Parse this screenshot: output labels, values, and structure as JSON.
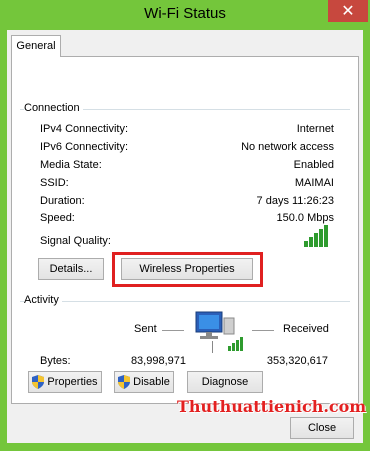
{
  "window": {
    "title": "Wi-Fi Status",
    "close_glyph": "✕"
  },
  "tabs": [
    {
      "label": "General"
    }
  ],
  "connection": {
    "title": "Connection",
    "rows": [
      {
        "label": "IPv4 Connectivity:",
        "value": "Internet"
      },
      {
        "label": "IPv6 Connectivity:",
        "value": "No network access"
      },
      {
        "label": "Media State:",
        "value": "Enabled"
      },
      {
        "label": "SSID:",
        "value": "MAIMAI"
      },
      {
        "label": "Duration:",
        "value": "7 days 11:26:23"
      },
      {
        "label": "Speed:",
        "value": "150.0 Mbps"
      }
    ],
    "signal_label": "Signal Quality:",
    "signal_bars": 5,
    "details_button": "Details...",
    "wireless_button": "Wireless Properties"
  },
  "activity": {
    "title": "Activity",
    "sent_label": "Sent",
    "received_label": "Received",
    "bytes_label": "Bytes:",
    "bytes_sent": "83,998,971",
    "bytes_received": "353,320,617",
    "icon": "network-computer-icon"
  },
  "buttons": {
    "properties": "Properties",
    "disable": "Disable",
    "diagnose": "Diagnose",
    "close": "Close"
  },
  "watermark": "Thuthuattienich.com",
  "colors": {
    "frame": "#74c63b",
    "close_button": "#c7483e",
    "highlight": "#e02020",
    "signal": "#2e9b2e"
  }
}
